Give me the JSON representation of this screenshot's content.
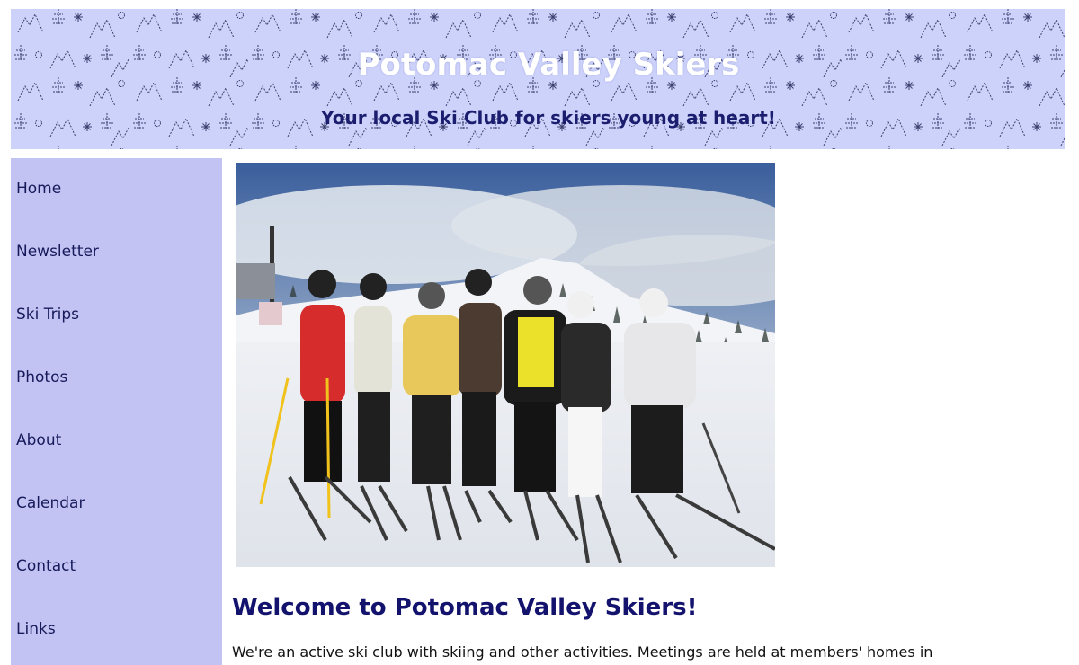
{
  "header": {
    "title": "Potomac Valley Skiers",
    "tagline": "Your local Ski Club for skiers young at heart!",
    "background_color": "#cdd2fb",
    "pattern_icons": [
      "mountain-icon",
      "tree-icon",
      "snowflake-icon"
    ]
  },
  "sidebar": {
    "background_color": "#c3c3f3",
    "items": [
      {
        "label": "Home"
      },
      {
        "label": "Newsletter"
      },
      {
        "label": "Ski Trips"
      },
      {
        "label": "Photos"
      },
      {
        "label": "About"
      },
      {
        "label": "Calendar"
      },
      {
        "label": "Contact"
      },
      {
        "label": "Links"
      }
    ]
  },
  "main": {
    "photo": "group-of-skiers-photo",
    "heading": "Welcome to Potomac Valley Skiers!",
    "intro": "We're an active ski club with skiing and other activities. Meetings are held at members' homes in"
  },
  "colors": {
    "heading": "#13136e",
    "nav_text": "#161a5a"
  }
}
